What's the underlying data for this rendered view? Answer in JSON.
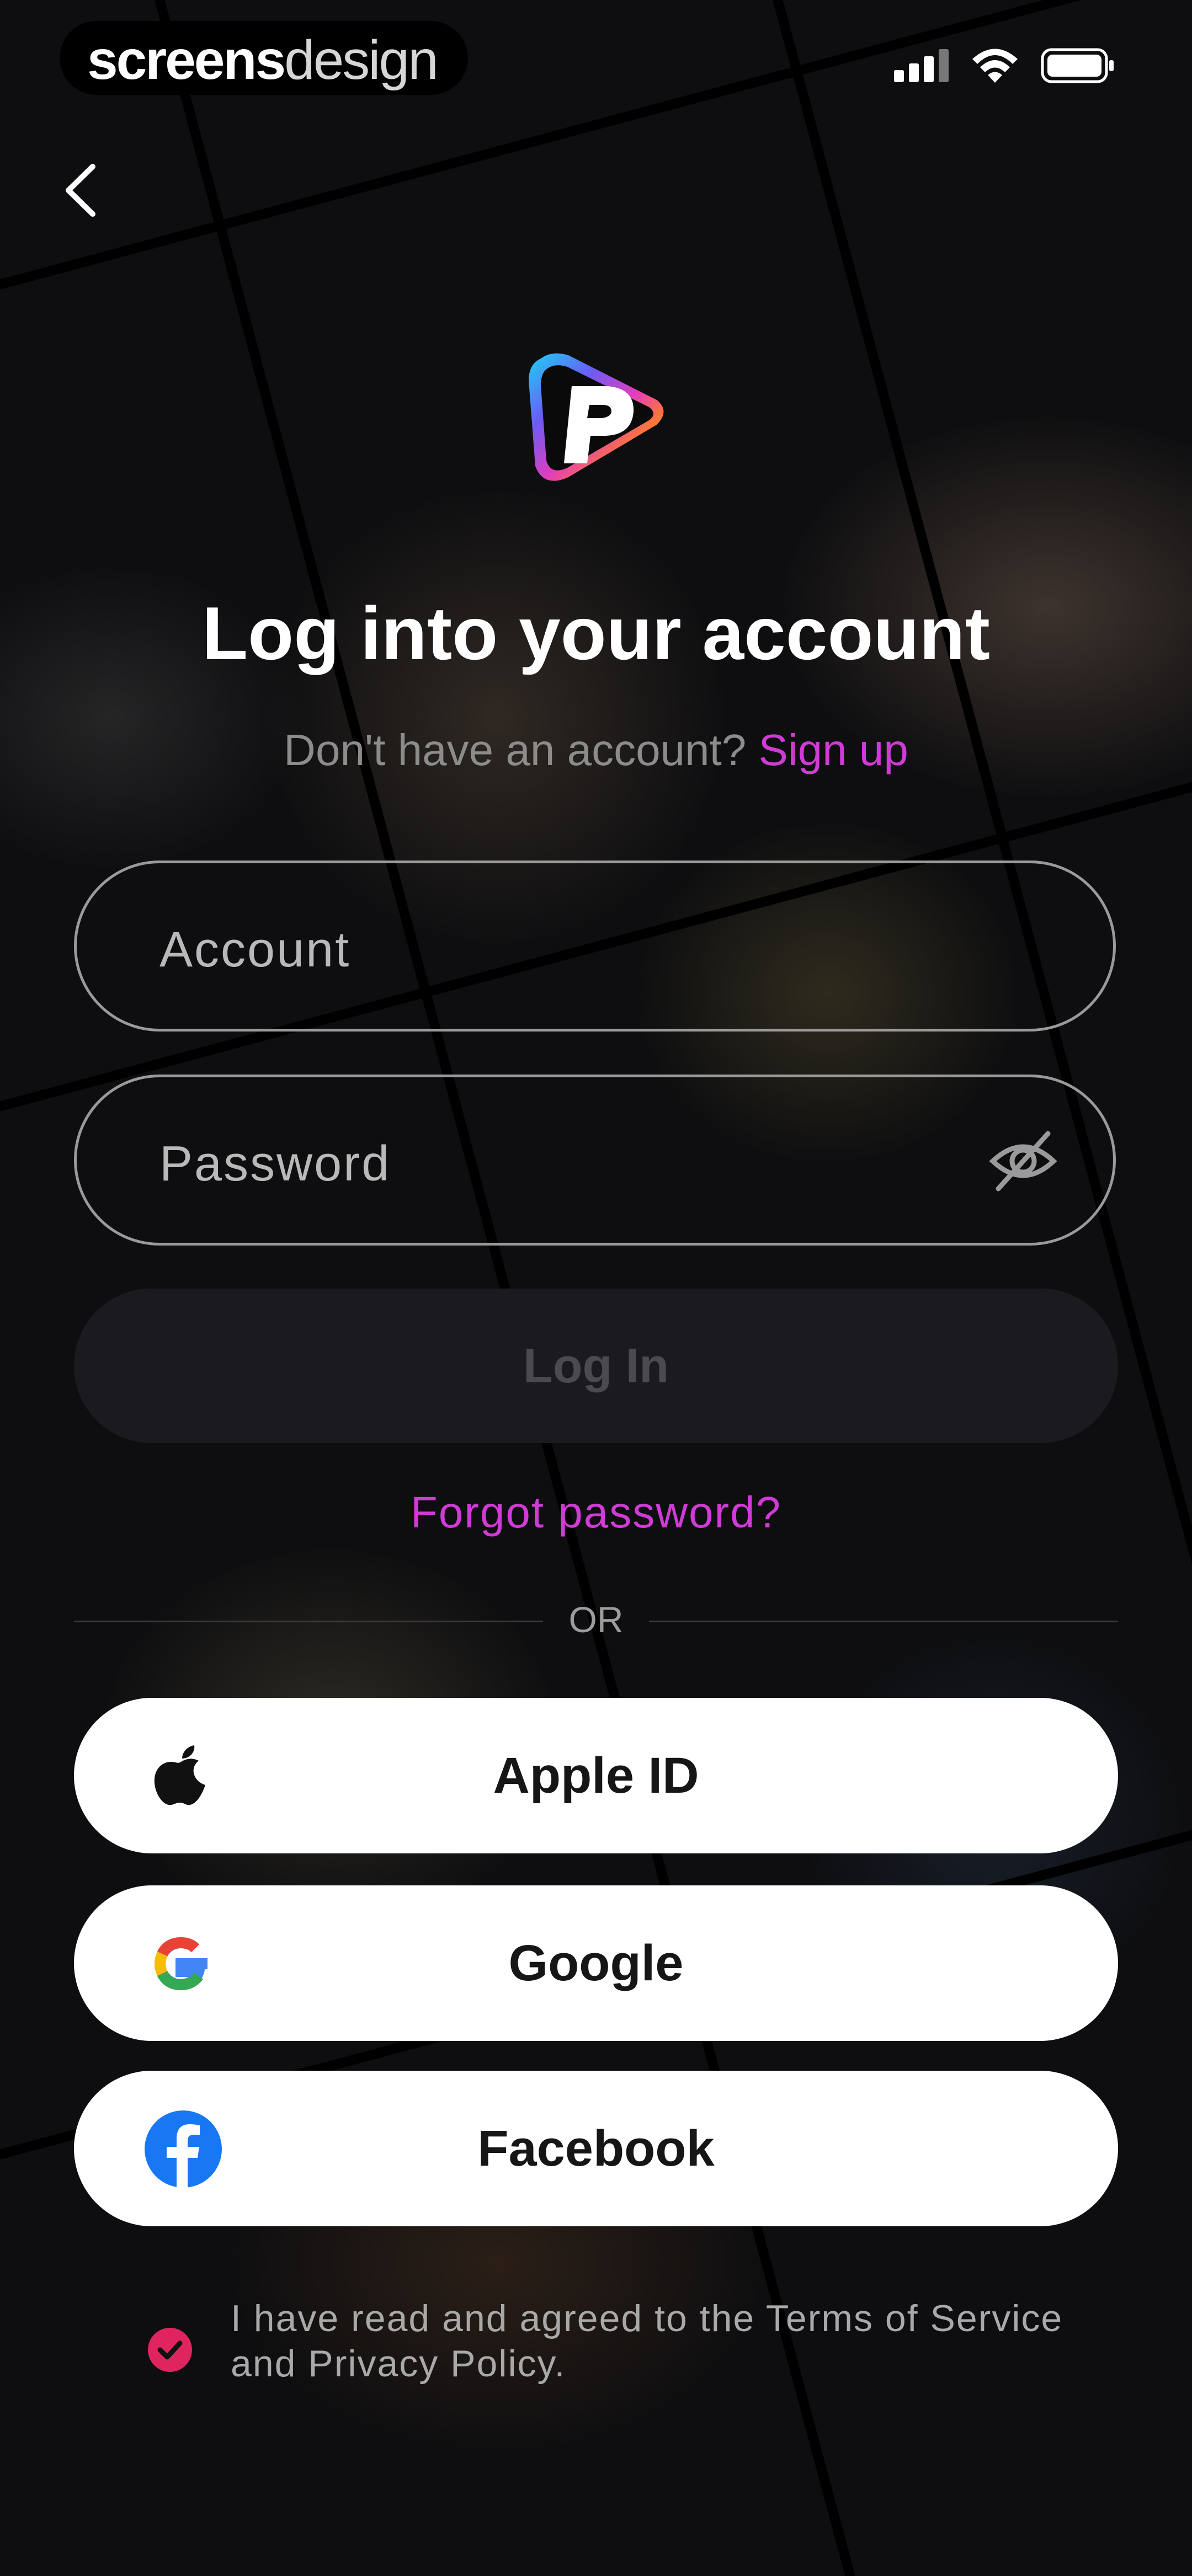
{
  "status_bar": {
    "brand_bold": "screens",
    "brand_light": "design"
  },
  "header": {
    "title": "Log into your account"
  },
  "signup": {
    "prompt": "Don't have an account?",
    "link": "Sign up"
  },
  "form": {
    "account_placeholder": "Account",
    "password_placeholder": "Password",
    "login_label": "Log In",
    "forgot_label": "Forgot password?"
  },
  "divider": {
    "text": "OR"
  },
  "social": [
    {
      "label": "Apple ID",
      "icon": "apple-icon"
    },
    {
      "label": "Google",
      "icon": "google-icon"
    },
    {
      "label": "Facebook",
      "icon": "facebook-icon"
    }
  ],
  "terms": {
    "text": "I have read and agreed to the Terms of Service and Privacy Policy.",
    "checked": true
  },
  "colors": {
    "accent": "#d03bd6",
    "check": "#e0245e",
    "facebook": "#1877f2"
  }
}
